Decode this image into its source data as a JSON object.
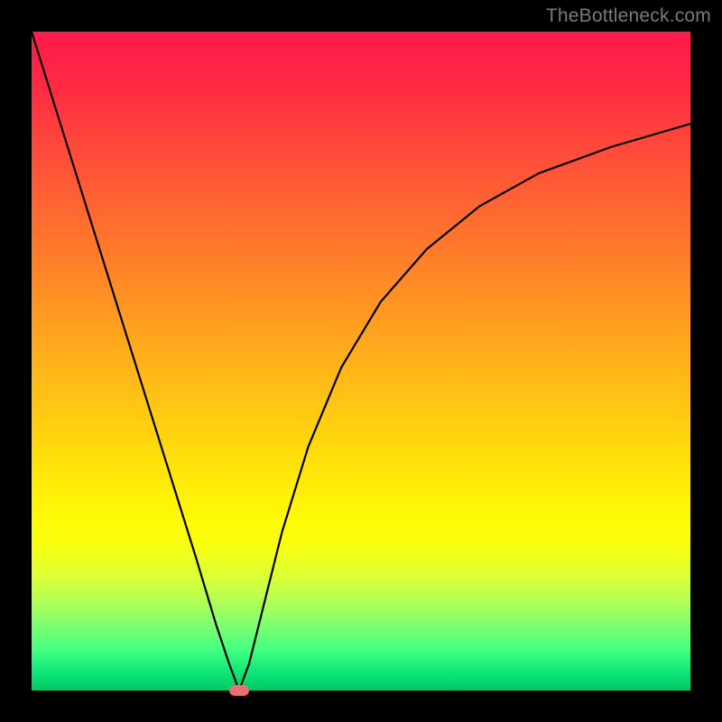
{
  "watermark": "TheBottleneck.com",
  "chart_data": {
    "type": "line",
    "title": "",
    "xlabel": "",
    "ylabel": "",
    "xlim": [
      0,
      100
    ],
    "ylim": [
      0,
      100
    ],
    "grid": false,
    "legend": false,
    "annotations": [],
    "series": [
      {
        "name": "bottleneck-curve",
        "x": [
          0,
          5,
          10,
          15,
          20,
          25,
          28,
          30,
          31.5,
          33,
          35,
          38,
          42,
          47,
          53,
          60,
          68,
          77,
          88,
          100
        ],
        "y": [
          100,
          84,
          68,
          52,
          36,
          20,
          10,
          4,
          0,
          4,
          12,
          24,
          37,
          49,
          59,
          67,
          73.5,
          78.5,
          82.5,
          86
        ]
      }
    ],
    "marker": {
      "x": 31.5,
      "y": 0,
      "color": "#e87070"
    },
    "background_gradient": {
      "top": "#ff1a4d",
      "mid": "#ffd700",
      "bottom": "#00c868"
    }
  }
}
